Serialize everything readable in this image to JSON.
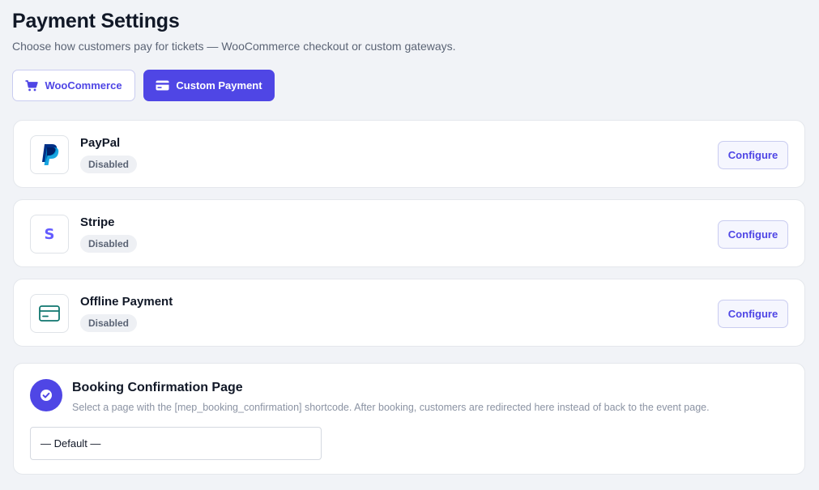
{
  "header": {
    "title": "Payment Settings",
    "subtitle": "Choose how customers pay for tickets — WooCommerce checkout or custom gateways."
  },
  "modes": {
    "woocommerce_label": "WooCommerce",
    "custom_label": "Custom Payment",
    "selected": "Custom Payment"
  },
  "gateways": [
    {
      "name": "PayPal",
      "status": "Disabled",
      "configure_label": "Configure",
      "icon": "paypal-icon"
    },
    {
      "name": "Stripe",
      "status": "Disabled",
      "configure_label": "Configure",
      "icon": "stripe-icon"
    },
    {
      "name": "Offline Payment",
      "status": "Disabled",
      "configure_label": "Configure",
      "icon": "credit-card-icon"
    }
  ],
  "confirmation": {
    "title": "Booking Confirmation Page",
    "description": "Select a page with the [mep_booking_confirmation] shortcode. After booking, customers are redirected here instead of back to the event page.",
    "selected_page": "— Default —",
    "icon": "check-circle-icon"
  },
  "colors": {
    "accent": "#4f46e5",
    "background": "#f1f3f7",
    "offline_icon": "#0f766e",
    "stripe_icon": "#635bff",
    "paypal_dark": "#003087",
    "paypal_light": "#009cde"
  }
}
